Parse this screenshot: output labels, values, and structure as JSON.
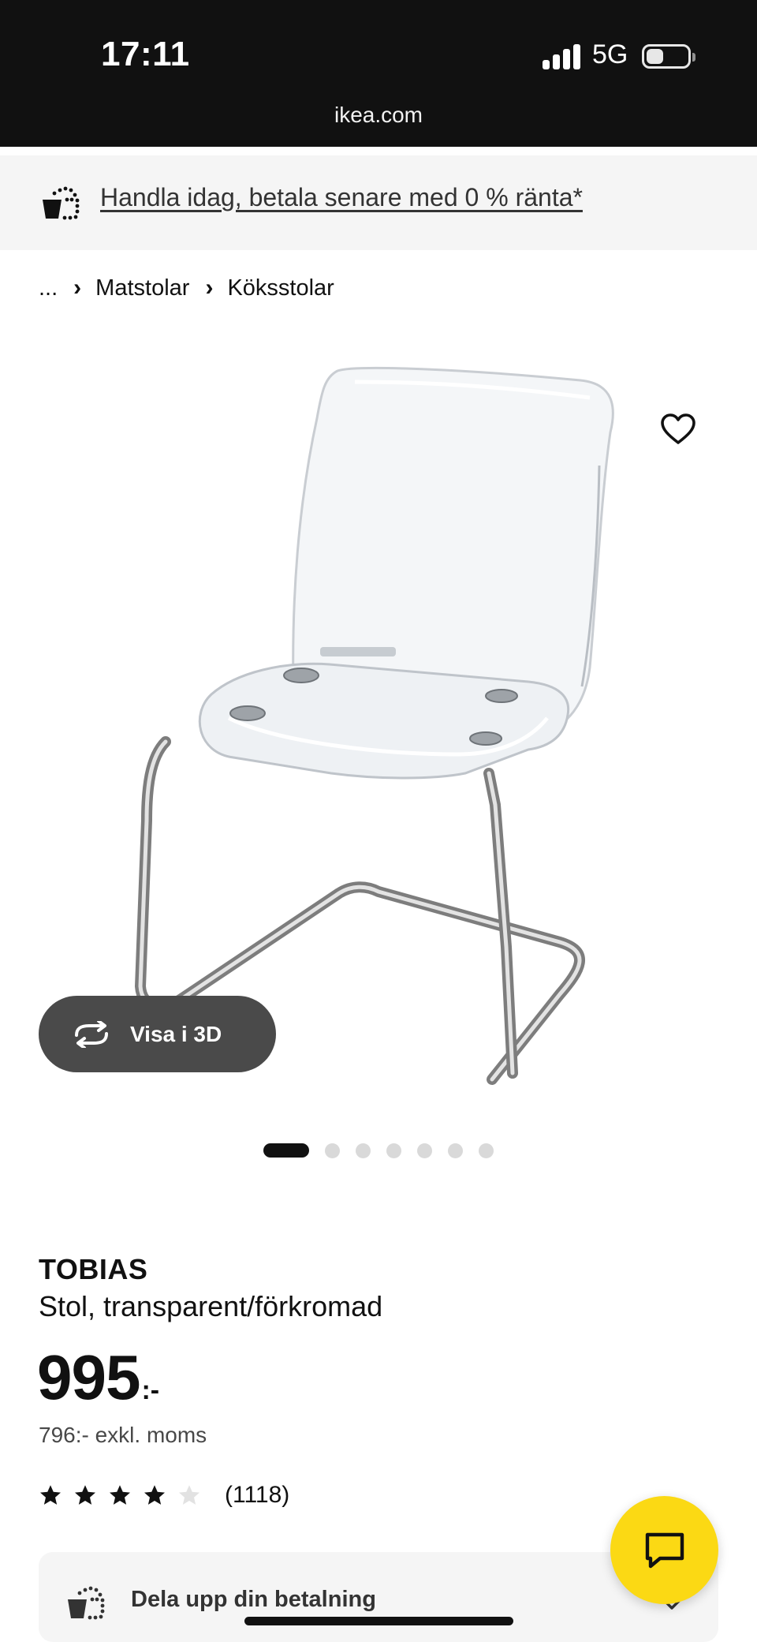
{
  "status_bar": {
    "time": "17:11",
    "network": "5G",
    "url": "ikea.com"
  },
  "promo": {
    "icon": "pay-later-basket-icon",
    "text": "Handla idag, betala senare med 0 % ränta*"
  },
  "breadcrumb": {
    "items": [
      "...",
      "Matstolar",
      "Köksstolar"
    ],
    "separator": "›"
  },
  "gallery": {
    "image": "chair-photo",
    "favorite_icon": "heart-outline-icon",
    "view3d_label": "Visa i 3D",
    "view3d_icon": "rotate-3d-icon",
    "total_images": 7,
    "active_index": 0
  },
  "product": {
    "name": "TOBIAS",
    "description": "Stol, transparent/förkromad",
    "price_integer": "995",
    "price_suffix": ":-",
    "price_excl_vat": "796:- exkl. moms",
    "rating": 4,
    "rating_max": 5,
    "review_count": "(1118)"
  },
  "payment": {
    "icon": "pay-later-basket-icon",
    "label": "Dela upp din betalning"
  },
  "chat": {
    "icon": "chat-bubble-icon"
  },
  "colors": {
    "status_bar_bg": "#111111",
    "promo_bg": "#f5f5f5",
    "pill_bg": "#4a4a4a",
    "chat_fab": "#fbd914",
    "star_filled": "#111111",
    "star_empty": "#dddddd"
  }
}
